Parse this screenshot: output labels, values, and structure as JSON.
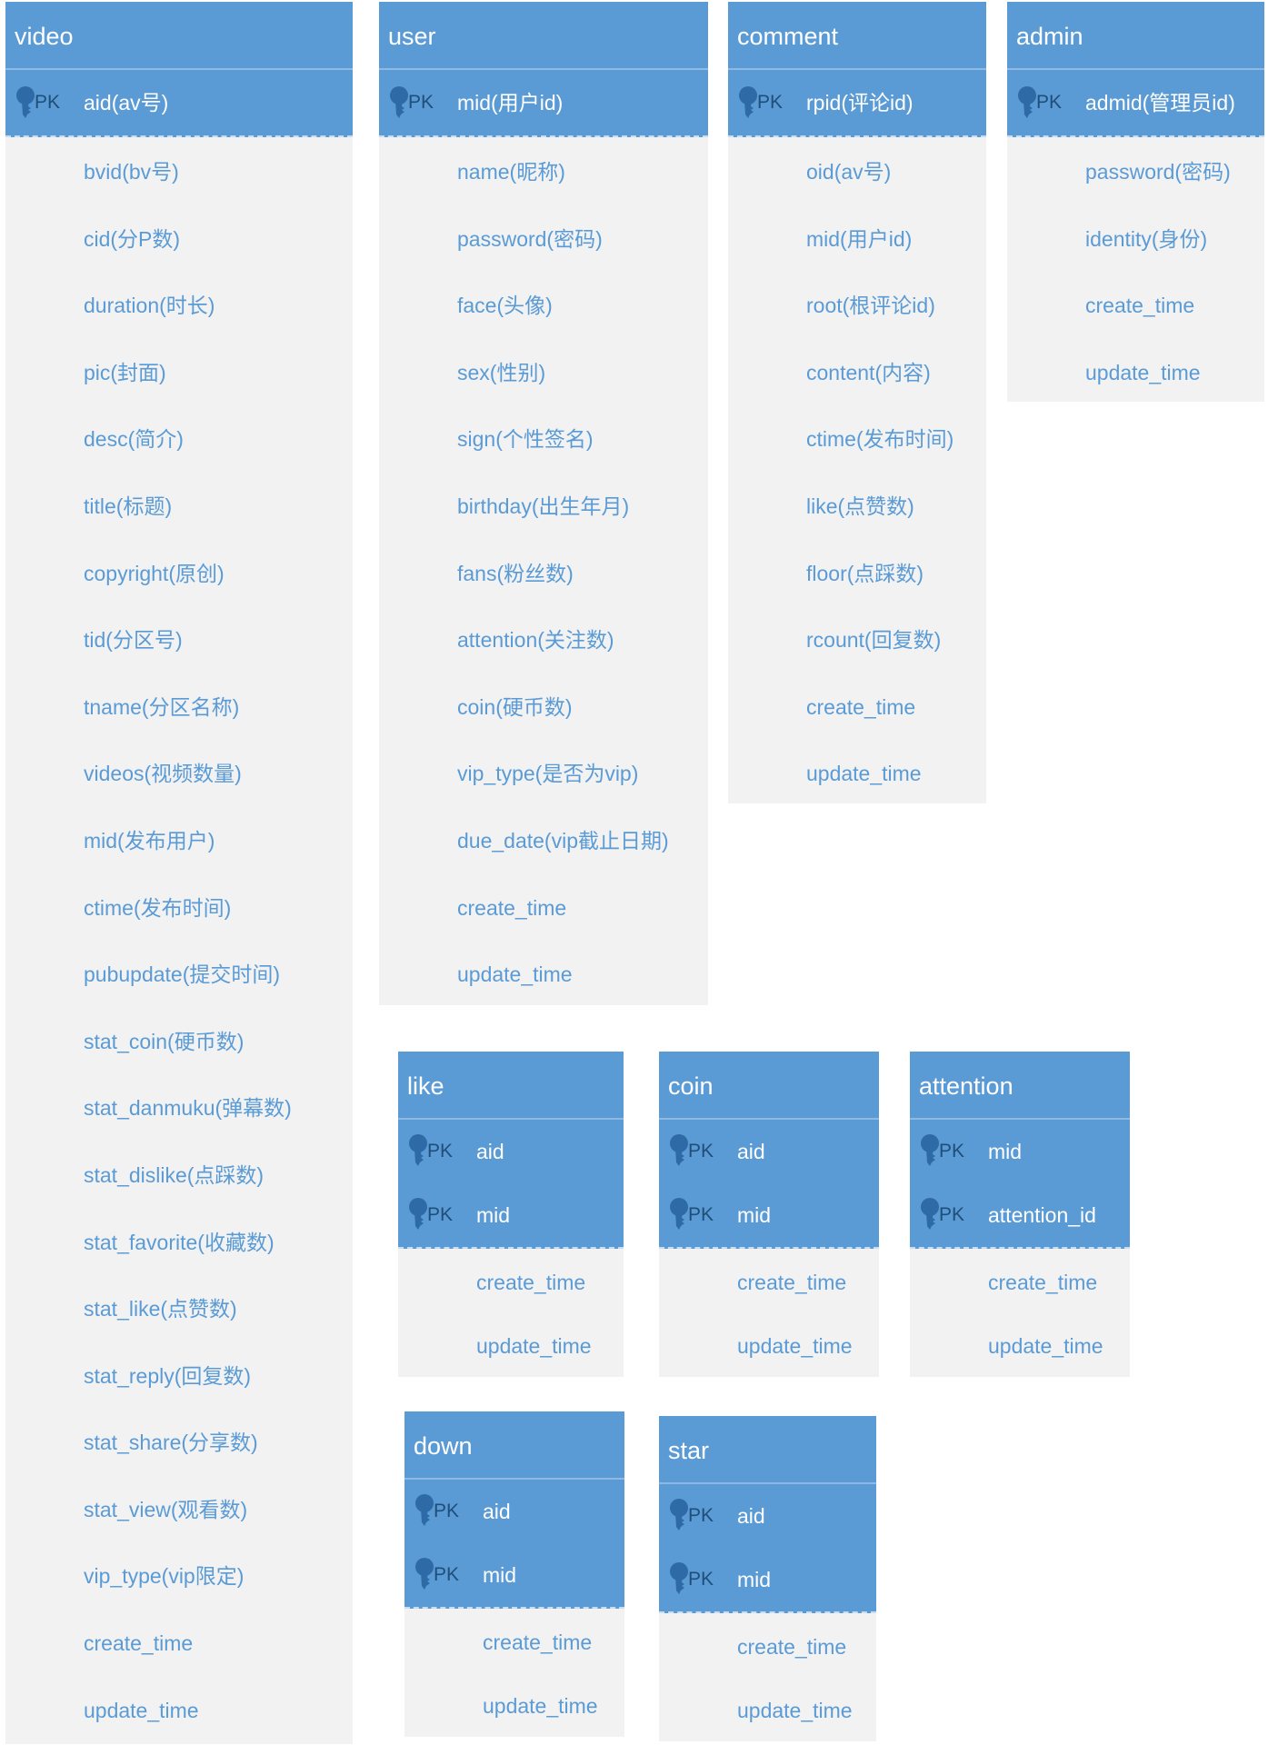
{
  "pk_label": "PK",
  "colors": {
    "header": "#5b9bd5",
    "body": "#f2f2f2",
    "field_text": "#5b9bd5",
    "key_icon": "#2e6aa6"
  },
  "tables": {
    "video": {
      "name": "video",
      "pk": [
        "aid(av号)"
      ],
      "fields": [
        "bvid(bv号)",
        "cid(分P数)",
        "duration(时长)",
        "pic(封面)",
        "desc(简介)",
        "title(标题)",
        "copyright(原创)",
        "tid(分区号)",
        "tname(分区名称)",
        "videos(视频数量)",
        "mid(发布用户)",
        "ctime(发布时间)",
        "pubupdate(提交时间)",
        "stat_coin(硬币数)",
        "stat_danmuku(弹幕数)",
        "stat_dislike(点踩数)",
        "stat_favorite(收藏数)",
        "stat_like(点赞数)",
        "stat_reply(回复数)",
        "stat_share(分享数)",
        "stat_view(观看数)",
        "vip_type(vip限定)",
        "create_time",
        "update_time"
      ]
    },
    "user": {
      "name": "user",
      "pk": [
        "mid(用户id)"
      ],
      "fields": [
        "name(昵称)",
        "password(密码)",
        "face(头像)",
        "sex(性别)",
        "sign(个性签名)",
        "birthday(出生年月)",
        "fans(粉丝数)",
        "attention(关注数)",
        "coin(硬币数)",
        "vip_type(是否为vip)",
        "due_date(vip截止日期)",
        "create_time",
        "update_time"
      ]
    },
    "comment": {
      "name": "comment",
      "pk": [
        "rpid(评论id)"
      ],
      "fields": [
        "oid(av号)",
        "mid(用户id)",
        "root(根评论id)",
        "content(内容)",
        "ctime(发布时间)",
        "like(点赞数)",
        "floor(点踩数)",
        "rcount(回复数)",
        "create_time",
        "update_time"
      ]
    },
    "admin": {
      "name": "admin",
      "pk": [
        "admid(管理员id)"
      ],
      "fields": [
        "password(密码)",
        "identity(身份)",
        "create_time",
        "update_time"
      ]
    },
    "like": {
      "name": "like",
      "pk": [
        "aid",
        "mid"
      ],
      "fields": [
        "create_time",
        "update_time"
      ]
    },
    "coin": {
      "name": "coin",
      "pk": [
        "aid",
        "mid"
      ],
      "fields": [
        "create_time",
        "update_time"
      ]
    },
    "attention": {
      "name": "attention",
      "pk": [
        "mid",
        "attention_id"
      ],
      "fields": [
        "create_time",
        "update_time"
      ]
    },
    "down": {
      "name": "down",
      "pk": [
        "aid",
        "mid"
      ],
      "fields": [
        "create_time",
        "update_time"
      ]
    },
    "star": {
      "name": "star",
      "pk": [
        "aid",
        "mid"
      ],
      "fields": [
        "create_time",
        "update_time"
      ]
    }
  }
}
